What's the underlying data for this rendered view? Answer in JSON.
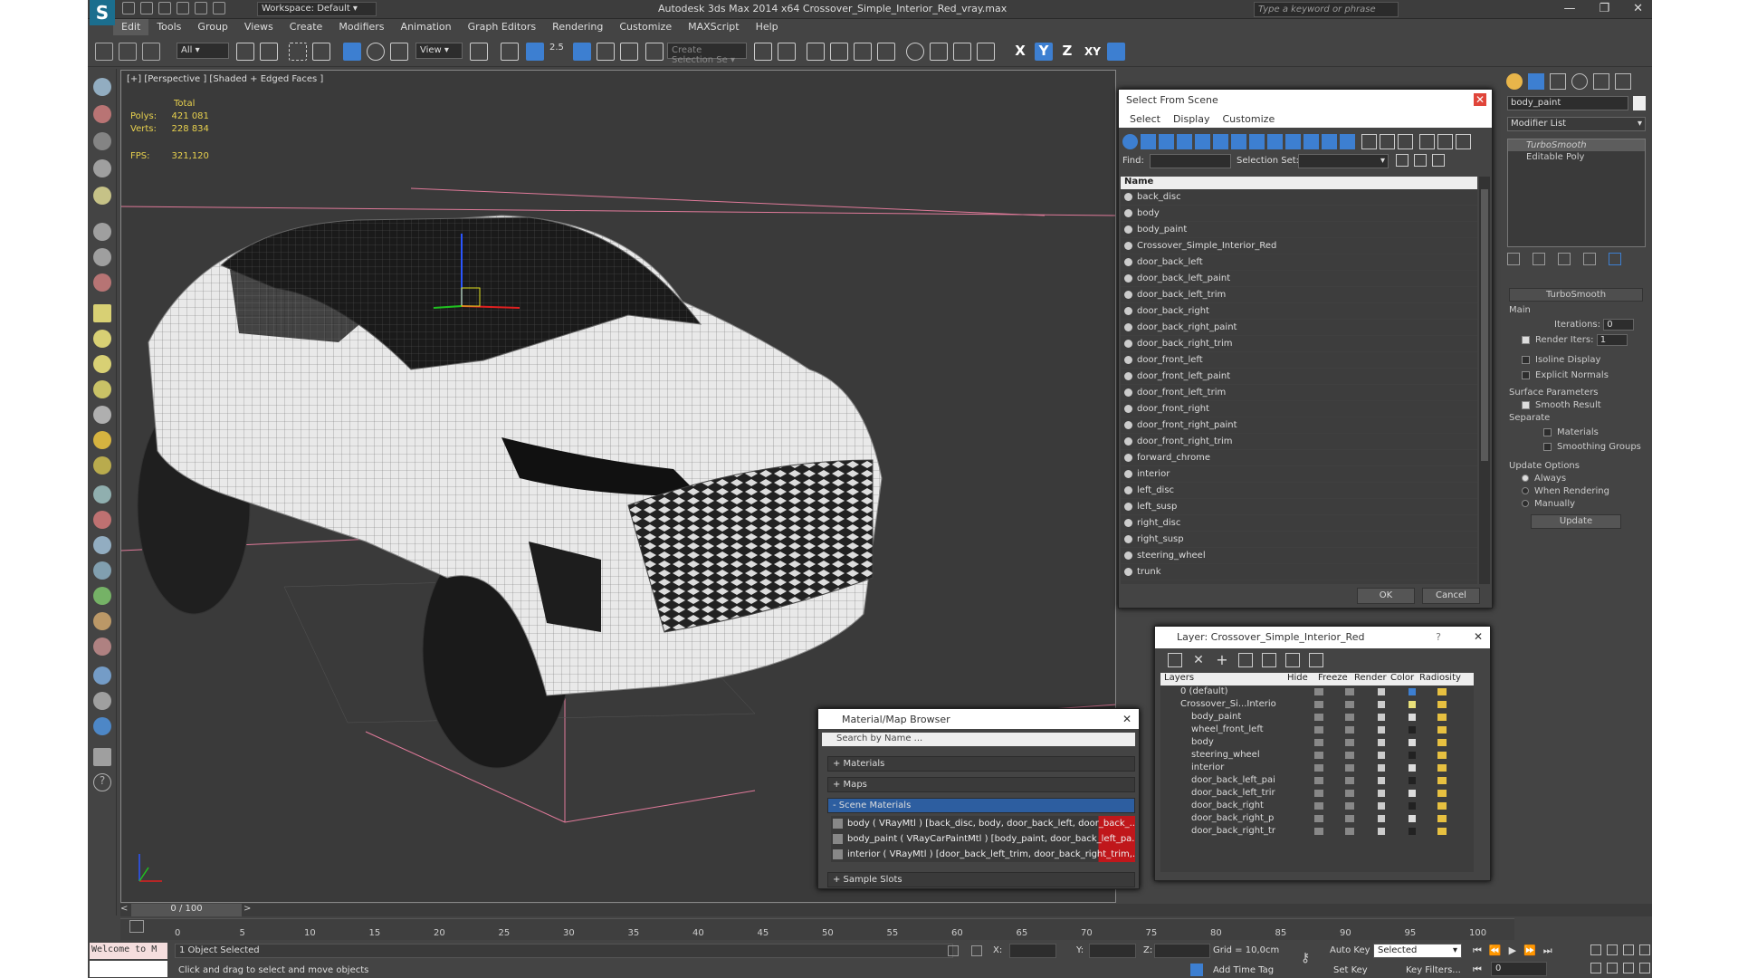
{
  "window": {
    "workspace": "Workspace: Default",
    "title": "Autodesk 3ds Max  2014 x64     Crossover_Simple_Interior_Red_vray.max",
    "search_placeholder": "Type a keyword or phrase",
    "buttons": [
      "—",
      "❐",
      "✕"
    ]
  },
  "menu": [
    "Edit",
    "Tools",
    "Group",
    "Views",
    "Create",
    "Modifiers",
    "Animation",
    "Graph Editors",
    "Rendering",
    "Customize",
    "MAXScript",
    "Help"
  ],
  "toolbar": {
    "selection_filter": "All",
    "ref_coord": "View",
    "named_selection": "Create Selection Se",
    "axis_labels": [
      "X",
      "Y",
      "Z",
      "XY"
    ],
    "snap_label": "2.5"
  },
  "viewport": {
    "label": "[+] [Perspective ] [Shaded + Edged Faces ]",
    "stats": {
      "header": "Total",
      "polys_label": "Polys:",
      "polys": "421 081",
      "verts_label": "Verts:",
      "verts": "228 834",
      "fps_label": "FPS:",
      "fps": "321,120"
    }
  },
  "command_panel": {
    "object_name": "body_paint",
    "modifier_list": "Modifier List",
    "stack": [
      "TurboSmooth",
      "Editable Poly"
    ],
    "rollout_title": "TurboSmooth",
    "main": "Main",
    "iterations_label": "Iterations:",
    "iterations": "0",
    "render_iters_label": "Render Iters:",
    "render_iters": "1",
    "isoline": "Isoline Display",
    "explicit_normals": "Explicit Normals",
    "surface_params": "Surface Parameters",
    "smooth_result": "Smooth Result",
    "separate": "Separate",
    "materials": "Materials",
    "smoothing_groups": "Smoothing Groups",
    "update_options": "Update Options",
    "always": "Always",
    "when_rendering": "When Rendering",
    "manually": "Manually",
    "update_btn": "Update"
  },
  "select_from_scene": {
    "title": "Select From Scene",
    "menu": [
      "Select",
      "Display",
      "Customize"
    ],
    "find_label": "Find:",
    "selection_set_label": "Selection Set:",
    "column": "Name",
    "items": [
      "back_disc",
      "body",
      "body_paint",
      "Crossover_Simple_Interior_Red",
      "door_back_left",
      "door_back_left_paint",
      "door_back_left_trim",
      "door_back_right",
      "door_back_right_paint",
      "door_back_right_trim",
      "door_front_left",
      "door_front_left_paint",
      "door_front_left_trim",
      "door_front_right",
      "door_front_right_paint",
      "door_front_right_trim",
      "forward_chrome",
      "interior",
      "left_disc",
      "left_susp",
      "right_disc",
      "right_susp",
      "steering_wheel",
      "trunk"
    ],
    "ok": "OK",
    "cancel": "Cancel"
  },
  "layer_dialog": {
    "title": "Layer: Crossover_Simple_Interior_Red",
    "help": "?",
    "columns": [
      "Layers",
      "Hide",
      "Freeze",
      "Render",
      "Color",
      "Radiosity"
    ],
    "rows": [
      "0 (default)",
      "Crossover_Si...Interio",
      "body_paint",
      "wheel_front_left",
      "body",
      "steering_wheel",
      "interior",
      "door_back_left_pai",
      "door_back_left_trir",
      "door_back_right",
      "door_back_right_p",
      "door_back_right_tr"
    ]
  },
  "material_browser": {
    "title": "Material/Map Browser",
    "search_placeholder": "Search by Name ...",
    "sections": [
      "+ Materials",
      "+ Maps",
      "- Scene Materials"
    ],
    "scene_materials": [
      "body ( VRayMtl ) [back_disc, body, door_back_left, door_back_...",
      "body_paint ( VRayCarPaintMtl ) [body_paint, door_back_left_pa...",
      "interior ( VRayMtl ) [door_back_left_trim, door_back_right_trim,..."
    ],
    "sample_slots": "+ Sample Slots"
  },
  "timeline": {
    "frame": "0 / 100",
    "ticks": [
      "0",
      "5",
      "10",
      "15",
      "20",
      "25",
      "30",
      "35",
      "40",
      "45",
      "50",
      "55",
      "60",
      "65",
      "70",
      "75",
      "80",
      "85",
      "90",
      "95",
      "100"
    ]
  },
  "status": {
    "maxscript": "Welcome to M",
    "selected": "1 Object Selected",
    "prompt": "Click and drag to select and move objects",
    "x_label": "X:",
    "y_label": "Y:",
    "z_label": "Z:",
    "grid": "Grid = 10,0cm",
    "add_time_tag": "Add Time Tag",
    "auto_key": "Auto Key",
    "set_key": "Set Key",
    "selected_dropdown": "Selected",
    "key_filters": "Key Filters...",
    "frame_field": "0"
  }
}
